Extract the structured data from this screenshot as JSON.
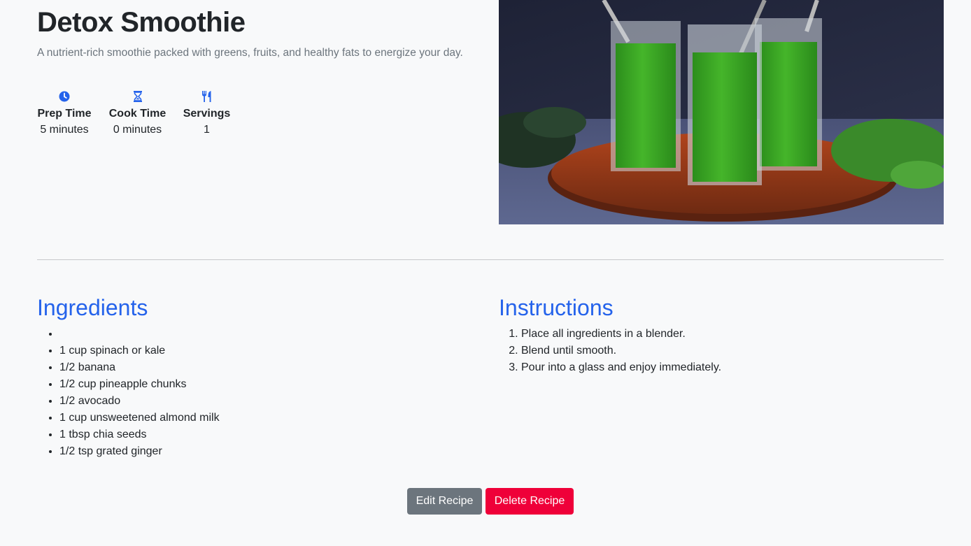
{
  "recipe": {
    "title": "Detox Smoothie",
    "description": "A nutrient-rich smoothie packed with greens, fruits, and healthy fats to energize your day."
  },
  "meta": [
    {
      "icon": "clock-icon",
      "label": "Prep Time",
      "value": "5 minutes"
    },
    {
      "icon": "hourglass-icon",
      "label": "Cook Time",
      "value": "0 minutes"
    },
    {
      "icon": "utensils-icon",
      "label": "Servings",
      "value": "1"
    }
  ],
  "ingredients": {
    "heading": "Ingredients",
    "items": [
      "",
      "1 cup spinach or kale",
      "1/2 banana",
      "1/2 cup pineapple chunks",
      "1/2 avocado",
      "1 cup unsweetened almond milk",
      "1 tbsp chia seeds",
      "1/2 tsp grated ginger"
    ]
  },
  "instructions": {
    "heading": "Instructions",
    "steps": [
      "Place all ingredients in a blender.",
      "Blend until smooth.",
      "Pour into a glass and enjoy immediately."
    ]
  },
  "actions": {
    "edit_label": "Edit Recipe",
    "delete_label": "Delete Recipe"
  },
  "colors": {
    "accent": "#2563eb",
    "edit_button": "#6c757d",
    "delete_button": "#ef0039"
  }
}
